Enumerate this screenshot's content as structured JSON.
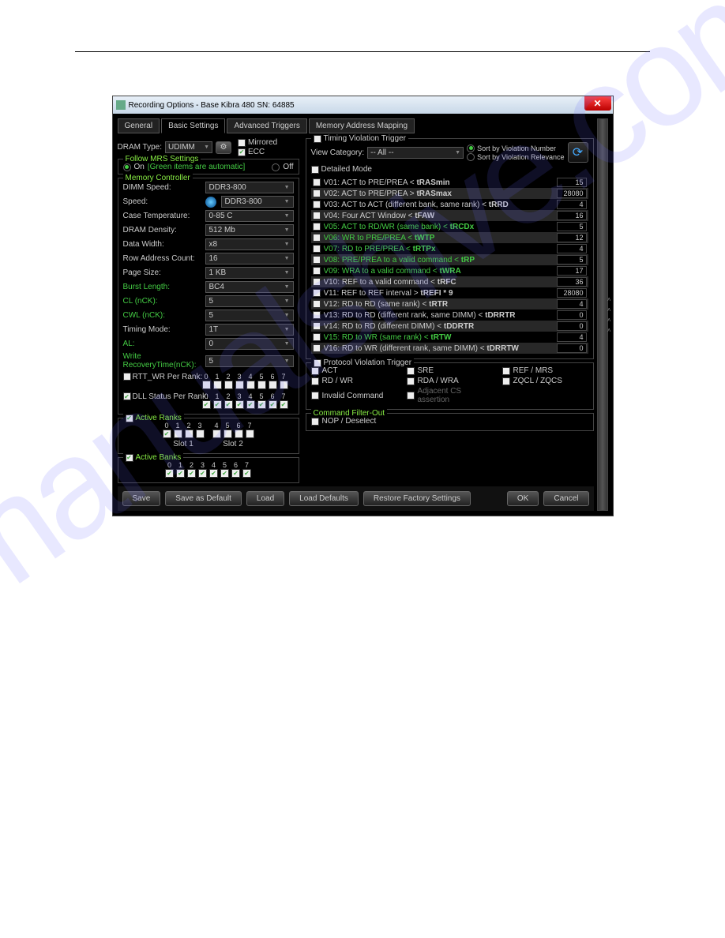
{
  "watermark": "manualshive.com",
  "window": {
    "title": "Recording Options - Base Kibra 480 SN: 64885"
  },
  "tabs": [
    "General",
    "Basic Settings",
    "Advanced Triggers",
    "Memory Address Mapping"
  ],
  "active_tab": 1,
  "dram_type": {
    "label": "DRAM Type:",
    "value": "UDIMM",
    "mirrored": "Mirrored",
    "ecc": "ECC",
    "ecc_checked": true,
    "mirrored_checked": false
  },
  "follow_mrs": {
    "legend": "Follow MRS Settings",
    "on": "On",
    "off": "Off",
    "hint": "[Green items are automatic]"
  },
  "memory_controller": {
    "legend": "Memory Controller",
    "rows": [
      {
        "label": "DIMM Speed:",
        "value": "DDR3-800",
        "green": false,
        "globe": false
      },
      {
        "label": "Speed:",
        "value": "DDR3-800",
        "green": false,
        "globe": true
      },
      {
        "label": "Case Temperature:",
        "value": "0-85 C",
        "green": false
      },
      {
        "label": "DRAM Density:",
        "value": "512 Mb",
        "green": false
      },
      {
        "label": "Data Width:",
        "value": "x8",
        "green": false
      },
      {
        "label": "Row Address Count:",
        "value": "16",
        "green": false
      },
      {
        "label": "Page Size:",
        "value": "1 KB",
        "green": false
      },
      {
        "label": "Burst Length:",
        "value": "BC4",
        "green": true
      },
      {
        "label": "CL (nCK):",
        "value": "5",
        "green": true
      },
      {
        "label": "CWL (nCK):",
        "value": "5",
        "green": true
      },
      {
        "label": "Timing Mode:",
        "value": "1T",
        "green": false
      },
      {
        "label": "AL:",
        "value": "0",
        "green": true
      },
      {
        "label": "Write RecoveryTime(nCK):",
        "value": "5",
        "green": true
      }
    ],
    "rtt_wr": {
      "label": "RTT_WR Per Rank:",
      "checked": false
    },
    "dll_status": {
      "label": "DLL Status Per Rank:",
      "checked": true
    }
  },
  "bit_labels": [
    "0",
    "1",
    "2",
    "3",
    "4",
    "5",
    "6",
    "7"
  ],
  "active_ranks": {
    "legend": "Active Ranks",
    "checked": true,
    "slot1": "Slot 1",
    "slot2": "Slot 2",
    "ranks1": [
      true,
      false,
      false,
      false
    ],
    "ranks2": [
      false,
      false,
      false,
      false
    ],
    "nums1": [
      "0",
      "1",
      "2",
      "3"
    ],
    "nums2": [
      "4",
      "5",
      "6",
      "7"
    ]
  },
  "active_banks": {
    "legend": "Active Banks",
    "checked": true,
    "banks": [
      true,
      true,
      true,
      true,
      true,
      true,
      true,
      true
    ]
  },
  "timing_violation": {
    "legend": "Timing Violation Trigger",
    "view_category_label": "View Category:",
    "view_category_value": "-- All --",
    "sort_num": "Sort by Violation Number",
    "sort_rel": "Sort by Violation Relevance",
    "detailed": "Detailed Mode",
    "rows": [
      {
        "chk": false,
        "txt": "V01: ACT to PRE/PREA < tRASmin",
        "green": false,
        "bold": "tRASmin",
        "val": "15",
        "alt": false
      },
      {
        "chk": false,
        "txt": "V02: ACT to PRE/PREA > tRASmax",
        "green": false,
        "bold": "tRASmax",
        "val": "28080",
        "alt": true
      },
      {
        "chk": false,
        "txt": "V03: ACT to ACT (different bank, same rank) < tRRD",
        "green": false,
        "bold": "tRRD",
        "val": "4",
        "alt": false
      },
      {
        "chk": false,
        "txt": "V04: Four ACT Window < tFAW",
        "green": false,
        "bold": "tFAW",
        "val": "16",
        "alt": true
      },
      {
        "chk": false,
        "txt": "V05: ACT to RD/WR (same bank) < tRCDx",
        "green": true,
        "bold": "tRCDx",
        "val": "5",
        "alt": false
      },
      {
        "chk": false,
        "txt": "V06: WR to PRE/PREA < tWTP",
        "green": true,
        "bold": "tWTP",
        "val": "12",
        "alt": true
      },
      {
        "chk": false,
        "txt": "V07: RD to PRE/PREA < tRTPx",
        "green": true,
        "bold": "tRTPx",
        "val": "4",
        "alt": false
      },
      {
        "chk": false,
        "txt": "V08: PRE/PREA to a valid command < tRP",
        "green": true,
        "bold": "tRP",
        "val": "5",
        "alt": true
      },
      {
        "chk": false,
        "txt": "V09: WRA to a valid command < tWRA",
        "green": true,
        "bold": "tWRA",
        "val": "17",
        "alt": false
      },
      {
        "chk": false,
        "txt": "V10: REF to a valid command < tRFC",
        "green": false,
        "bold": "tRFC",
        "val": "36",
        "alt": true
      },
      {
        "chk": false,
        "txt": "V11: REF to REF interval > tREFI * 9",
        "green": false,
        "bold": "tREFI * 9",
        "val": "28080",
        "alt": false
      },
      {
        "chk": false,
        "txt": "V12: RD to RD (same rank) < tRTR",
        "green": false,
        "bold": "tRTR",
        "val": "4",
        "alt": true
      },
      {
        "chk": false,
        "txt": "V13: RD to RD (different rank, same DIMM) < tDRRTR",
        "green": false,
        "bold": "tDRRTR",
        "val": "0",
        "alt": false
      },
      {
        "chk": false,
        "txt": "V14: RD to RD (different DIMM) < tDDRTR",
        "green": false,
        "bold": "tDDRTR",
        "val": "0",
        "alt": true
      },
      {
        "chk": false,
        "txt": "V15: RD to WR (same rank) < tRTW",
        "green": true,
        "bold": "tRTW",
        "val": "4",
        "alt": false
      },
      {
        "chk": false,
        "txt": "V16: RD to WR (different rank, same DIMM) < tDRRTW",
        "green": false,
        "bold": "tDRRTW",
        "val": "0",
        "alt": true
      }
    ]
  },
  "protocol_violation": {
    "legend": "Protocol Violation Trigger",
    "items": [
      {
        "label": "ACT",
        "chk": false,
        "dis": false
      },
      {
        "label": "SRE",
        "chk": false,
        "dis": false
      },
      {
        "label": "REF / MRS",
        "chk": false,
        "dis": false
      },
      {
        "label": "RD / WR",
        "chk": false,
        "dis": false
      },
      {
        "label": "RDA / WRA",
        "chk": false,
        "dis": false
      },
      {
        "label": "ZQCL / ZQCS",
        "chk": false,
        "dis": false
      },
      {
        "label": "Invalid Command",
        "chk": false,
        "dis": false
      },
      {
        "label": "Adjacent CS assertion",
        "chk": false,
        "dis": true
      }
    ]
  },
  "command_filter": {
    "legend": "Command Filter-Out",
    "nop": "NOP / Deselect"
  },
  "buttons": {
    "save": "Save",
    "save_default": "Save as Default",
    "load": "Load",
    "load_defaults": "Load Defaults",
    "restore": "Restore Factory Settings",
    "ok": "OK",
    "cancel": "Cancel"
  }
}
